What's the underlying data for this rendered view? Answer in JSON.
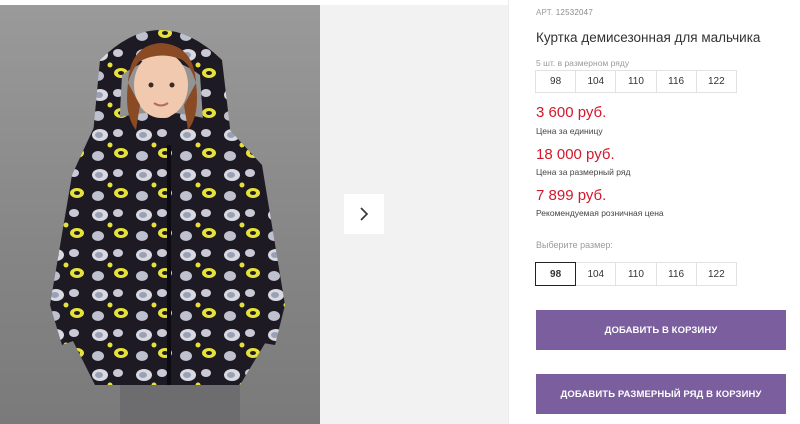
{
  "gallery": {
    "photo_alt": "Фото товара",
    "next_icon": "chevron-right-icon"
  },
  "product": {
    "art_label": "АРТ.",
    "art_value": "12532047",
    "title": "Куртка демисезонная для мальчика",
    "pack_label": "5 шт. в размерном ряду",
    "pack_sizes": [
      "98",
      "104",
      "110",
      "116",
      "122"
    ]
  },
  "prices": [
    {
      "value": "3 600 руб.",
      "note": "Цена за единицу"
    },
    {
      "value": "18 000 руб.",
      "note": "Цена за размерный ряд"
    },
    {
      "value": "7 899 руб.",
      "note": "Рекомендуемая розничная цена"
    }
  ],
  "size_select": {
    "label": "Выберите размер:",
    "options": [
      "98",
      "104",
      "110",
      "116",
      "122"
    ],
    "selected": "98"
  },
  "actions": {
    "add_to_cart": "ДОБАВИТЬ В КОРЗИНУ",
    "add_pack_to_cart": "ДОБАВИТЬ РАЗМЕРНЫЙ РЯД В КОРЗИНУ"
  },
  "colors": {
    "price": "#d3182b",
    "button": "#7b5e9e",
    "jacket": "#1d1a24",
    "print_yellow": "#e7e23a"
  }
}
